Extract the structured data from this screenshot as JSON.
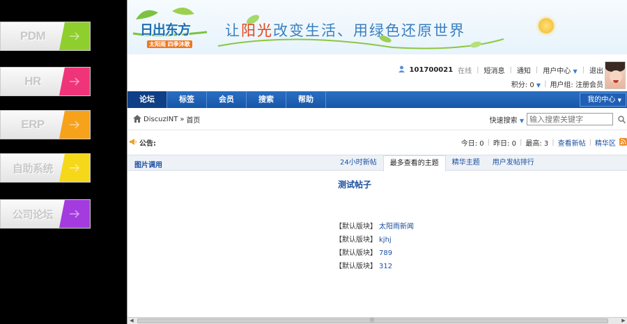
{
  "sidebar": {
    "tiles": [
      {
        "label": "PDM",
        "color": "#8fcf2d"
      },
      {
        "label": "HR",
        "color": "#f0347a"
      },
      {
        "label": "ERP",
        "color": "#f7a21b"
      },
      {
        "label": "自助系统",
        "color": "#f6d81a"
      },
      {
        "label": "公司论坛",
        "color": "#a33bde"
      }
    ]
  },
  "banner": {
    "logo_title": "日出东方",
    "logo_sub": "太阳雨 四季沐歌",
    "slogan_1": "让",
    "slogan_2": "阳光",
    "slogan_3": "改变生活",
    "slogan_4": "用",
    "slogan_5": "绿色还原世界"
  },
  "user": {
    "id": "101700021",
    "status": "在线",
    "messages": "短消息",
    "notify": "通知",
    "center": "用户中心",
    "logout": "退出",
    "points": "积分: 0",
    "group": "用户组: 注册会员"
  },
  "nav": {
    "items": [
      "论坛",
      "标签",
      "会员",
      "搜索",
      "帮助"
    ],
    "my_center": "我的中心"
  },
  "breadcrumb": {
    "site": "DiscuzINT",
    "sep": "»",
    "page": "首页"
  },
  "search": {
    "label": "快速搜索",
    "placeholder": "输入搜索关键字"
  },
  "notice": {
    "label": "公告:"
  },
  "stats": {
    "today": "今日: 0",
    "yesterday": "昨日: 0",
    "max": "最高: 3",
    "new_posts": "查看新帖",
    "digest_zone": "精华区"
  },
  "panel": {
    "title": "图片调用",
    "tabs": [
      "24小时新帖",
      "最多查看的主题",
      "精华主题",
      "用户发帖排行"
    ],
    "active_tab": 1
  },
  "content": {
    "post_title": "测试帖子",
    "posts": [
      {
        "board": "【默认版块】",
        "title": "太阳雨新闻"
      },
      {
        "board": "【默认版块】",
        "title": "kjhj"
      },
      {
        "board": "【默认版块】",
        "title": "789"
      },
      {
        "board": "【默认版块】",
        "title": "312"
      }
    ]
  }
}
